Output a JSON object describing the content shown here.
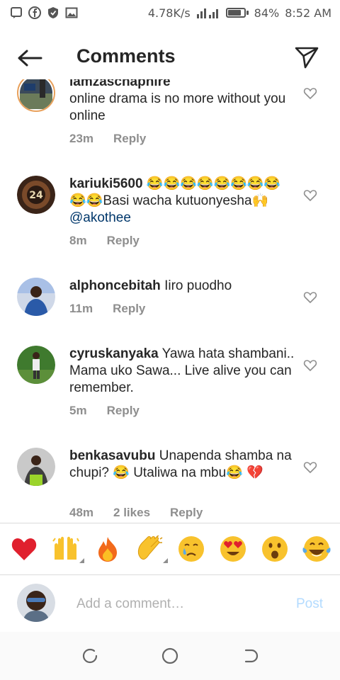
{
  "status_bar": {
    "speed": "4.78K/s",
    "battery": "84%",
    "battery_level": 0.84,
    "time": "8:52 AM"
  },
  "header": {
    "title": "Comments"
  },
  "comments": [
    {
      "username": "lamzaschaphire",
      "text": "online drama is no more without you online",
      "time": "23m",
      "reply": "Reply"
    },
    {
      "username": "kariuki5600",
      "emoji_lead": "😂😂😂😂😂😂😂😂😂😂",
      "text": "Basi wacha kutuonyesha🙌",
      "mention": "@akothee",
      "time": "8m",
      "reply": "Reply"
    },
    {
      "username": "alphoncebitah",
      "text": "Iiro puodho",
      "time": "11m",
      "reply": "Reply"
    },
    {
      "username": "cyruskanyaka",
      "text": "Yawa hata shambani.. Mama uko Sawa... Live alive you can remember.",
      "time": "5m",
      "reply": "Reply"
    },
    {
      "username": "benkasavubu",
      "text": "Unapenda shamba na chupi? 😂 Utaliwa na mbu😂 💔",
      "time": "48m",
      "likes": "2 likes",
      "reply": "Reply"
    }
  ],
  "reactions": [
    "red-heart",
    "raising-hands",
    "fire",
    "clapping-hands",
    "crying-face",
    "heart-eyes",
    "surprised-face",
    "tears-of-joy"
  ],
  "add_comment": {
    "placeholder": "Add a comment…",
    "post_label": "Post"
  },
  "colors": {
    "accent_disabled": "#b3dbff",
    "mention": "#00376b",
    "meta": "#8e8e8e"
  }
}
